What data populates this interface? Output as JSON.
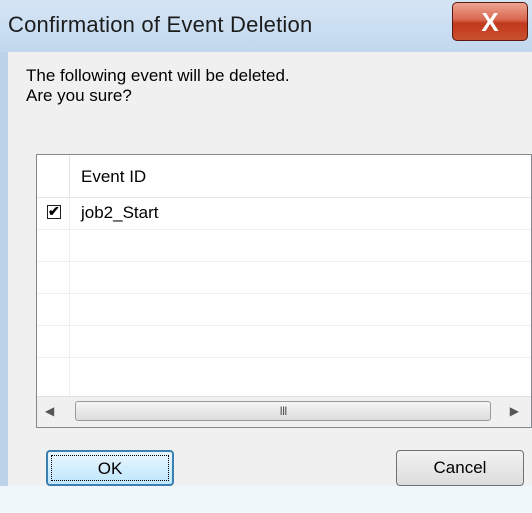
{
  "window": {
    "title": "Confirmation of Event Deletion",
    "close_glyph": "X"
  },
  "message": {
    "line1": "The following event will be deleted.",
    "line2": "Are you sure?"
  },
  "list": {
    "column_header": "Event ID",
    "rows": [
      {
        "checked": true,
        "check_glyph": "✔",
        "label": "job2_Start"
      },
      {
        "label": ""
      },
      {
        "label": ""
      },
      {
        "label": ""
      },
      {
        "label": ""
      }
    ],
    "scroll_left_glyph": "◀",
    "scroll_right_glyph": "▶",
    "scroll_grip": "III"
  },
  "buttons": {
    "ok": "OK",
    "cancel": "Cancel"
  },
  "colors": {
    "titlebar": "#c2d8ee",
    "close": "#c2391c",
    "dialog_bg": "#f0f0f0",
    "ok_border": "#3c7fb1"
  }
}
